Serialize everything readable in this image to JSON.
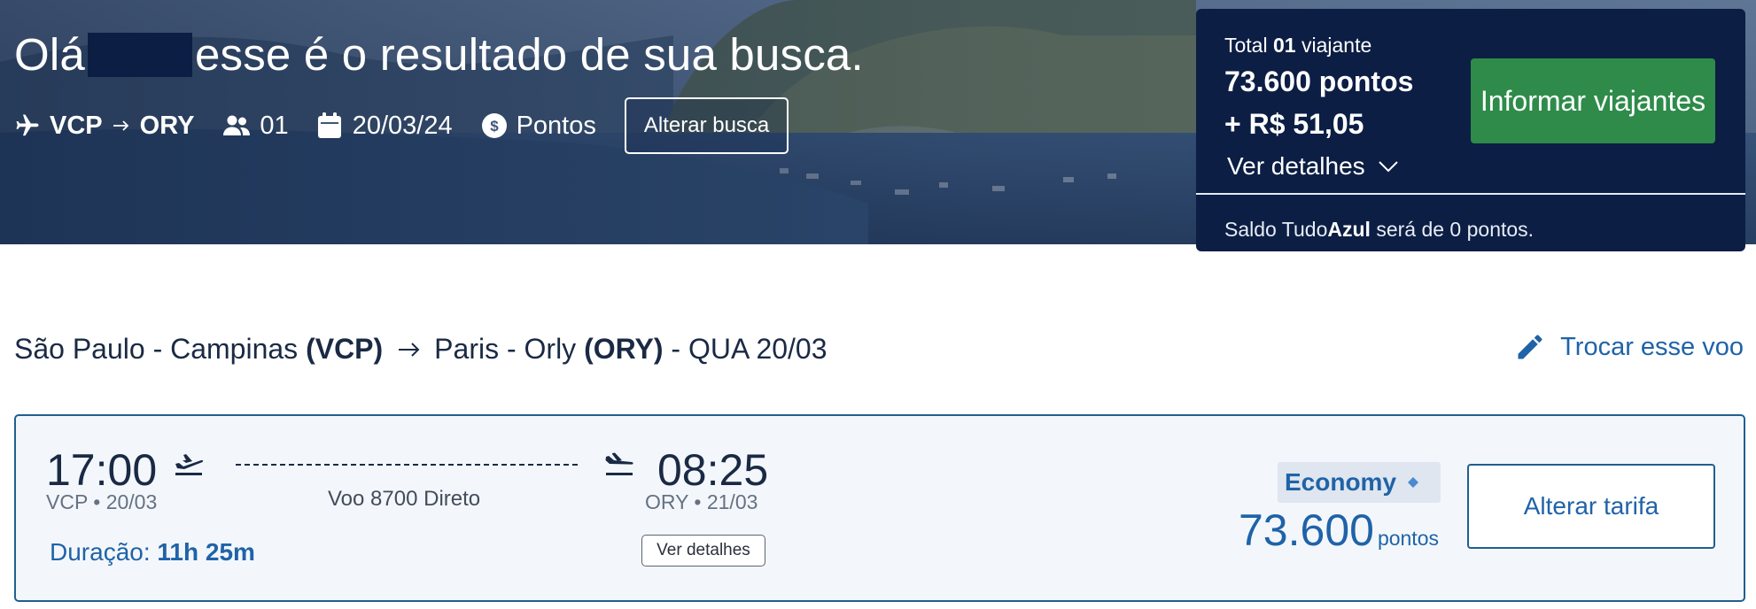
{
  "hero": {
    "greeting_prefix": "Olá",
    "greeting_suffix": "esse é o resultado de sua busca.",
    "origin": "VCP",
    "destination": "ORY",
    "passengers": "01",
    "date": "20/03/24",
    "payment": "Pontos",
    "alter_search_label": "Alterar busca"
  },
  "summary": {
    "total_prefix": "Total",
    "total_count": "01",
    "total_suffix": "viajante",
    "points": "73.600 pontos",
    "money": "+ R$ 51,05",
    "details_label": "Ver detalhes",
    "inform_label": "Informar viajantes",
    "saldo_prefix": "Saldo Tudo",
    "saldo_brand": "Azul",
    "saldo_suffix": "será de 0 pontos."
  },
  "route": {
    "origin_city": "São Paulo - Campinas",
    "origin_code": "(VCP)",
    "destination_city": "Paris - Orly",
    "destination_code": "(ORY)",
    "date": "- QUA 20/03",
    "swap_label": "Trocar esse voo"
  },
  "flight": {
    "departure_time": "17:00",
    "departure_sub": "VCP • 20/03",
    "arrival_time": "08:25",
    "arrival_sub": "ORY • 21/03",
    "flight_info": "Voo 8700 Direto",
    "duration_label": "Duração:",
    "duration_value": "11h 25m",
    "details_label": "Ver detalhes",
    "fare_class": "Economy",
    "price": "73.600",
    "price_unit": "pontos",
    "change_fare_label": "Alterar tarifa"
  },
  "colors": {
    "navy": "#0c1e44",
    "brand_blue": "#1f63a8",
    "green": "#2e8b4a",
    "card_border": "#1f5f8e"
  }
}
